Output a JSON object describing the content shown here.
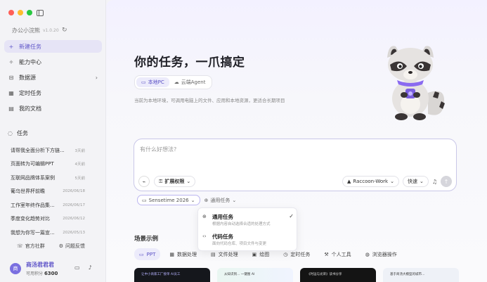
{
  "sidebar": {
    "app_name": "办公小浣熊",
    "version": "v1.0.20",
    "nav": [
      {
        "label": "新建任务",
        "icon": "plus-icon"
      },
      {
        "label": "能力中心",
        "icon": "sparkle-icon"
      },
      {
        "label": "数据源",
        "icon": "database-icon"
      },
      {
        "label": "定时任务",
        "icon": "calendar-icon"
      },
      {
        "label": "我的文档",
        "icon": "document-icon"
      }
    ],
    "tasks_heading": "任务",
    "tasks": [
      {
        "title": "请帮我全面分析下方链...",
        "time": "3天前"
      },
      {
        "title": "页面转为可编辑PPT",
        "time": "4天前"
      },
      {
        "title": "互联网品牌体系案例",
        "time": "5天前"
      },
      {
        "title": "葡乌世界杯前瞻",
        "time": "2026/06/18"
      },
      {
        "title": "工作室年终作品集...",
        "time": "2026/06/17"
      },
      {
        "title": "季度变化趋势对比",
        "time": "2026/06/12"
      },
      {
        "title": "我想为你写一篇宣...",
        "time": "2026/05/13"
      }
    ],
    "footer": {
      "community": "官方社群",
      "feedback": "问题反馈"
    },
    "user": {
      "avatar_text": "商",
      "name": "商汤君君君",
      "points_label": "可用积分",
      "points_value": "6300"
    }
  },
  "main": {
    "title": "你的任务，一爪搞定",
    "modes": [
      {
        "label": "本地PC"
      },
      {
        "label": "云端Agent"
      }
    ],
    "subtitle": "当前为本地环境，可调用电脑上的文件、应用和本地资源，更适合长期项目",
    "composer": {
      "placeholder": "有什么好想法?",
      "extend_label": "扩展权限",
      "model_label": "Raccoon-Work",
      "speed_label": "快速"
    },
    "context": {
      "folder_label": "Sensetime 2026",
      "mode_label": "通用任务"
    },
    "dropdown": [
      {
        "title": "通用任务",
        "desc": "根据内容自动选择合适的处理方式"
      },
      {
        "title": "代码任务",
        "desc": "面向代码仓库、项目文件与变更"
      }
    ],
    "examples_title": "场景示例",
    "tabs": [
      {
        "label": "PPT",
        "icon": "monitor-icon"
      },
      {
        "label": "数据处理",
        "icon": "table-icon"
      },
      {
        "label": "文件处理",
        "icon": "file-icon"
      },
      {
        "label": "绘图",
        "icon": "image-icon"
      },
      {
        "label": "定时任务",
        "icon": "clock-icon"
      },
      {
        "label": "个人工具",
        "icon": "wrench-icon"
      },
      {
        "label": "浏览器操作",
        "icon": "globe-icon"
      }
    ],
    "cards": [
      {
        "text": "让中小商家工厂接单 AI员工"
      },
      {
        "text": "从知识到… 一键图 AI"
      },
      {
        "text": "《时运与光荣》读书分享"
      },
      {
        "text": "基于商汤大模型的城市…"
      }
    ]
  }
}
